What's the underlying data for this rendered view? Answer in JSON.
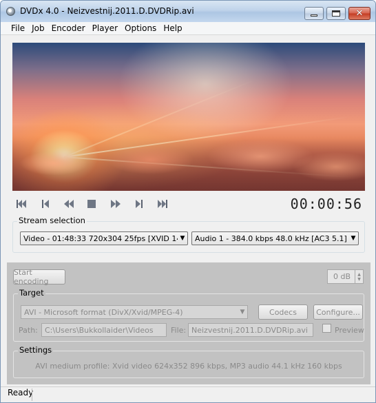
{
  "window": {
    "title": "DVDx 4.0 - Neizvestnij.2011.D.DVDRip.avi",
    "close_glyph": "✕"
  },
  "menu": [
    "File",
    "Job",
    "Encoder",
    "Player",
    "Options",
    "Help"
  ],
  "player": {
    "timecode": "00:00:56",
    "controls": [
      "skip-to-start-icon",
      "step-back-icon",
      "rewind-icon",
      "stop-icon",
      "play-icon",
      "step-forward-icon",
      "skip-to-end-icon"
    ]
  },
  "stream_selection": {
    "label": "Stream selection",
    "video": "Video - 01:48:33 720x304 25fps [XVID 1411.0",
    "audio": "Audio 1 - 384.0 kbps 48.0 kHz [AC3 5.1]"
  },
  "encoding": {
    "start_label": "Start encoding",
    "db_value": "0 dB"
  },
  "target": {
    "label": "Target",
    "format": "AVI - Microsoft format (DivX/Xvid/MPEG-4)",
    "codecs_label": "Codecs",
    "configure_label": "Configure...",
    "path_label": "Path:",
    "path_value": "C:\\Users\\Bukkollaider\\Videos",
    "file_label": "File:",
    "file_value": "Neizvestnij.2011.D.DVDRip.avi",
    "preview_label": "Preview",
    "preview_checked": false
  },
  "settings": {
    "label": "Settings",
    "text": "AVI medium profile: Xvid video 624x352 896 kbps,  MP3 audio 44.1 kHz 160 kbps"
  },
  "status": {
    "text": "Ready"
  }
}
